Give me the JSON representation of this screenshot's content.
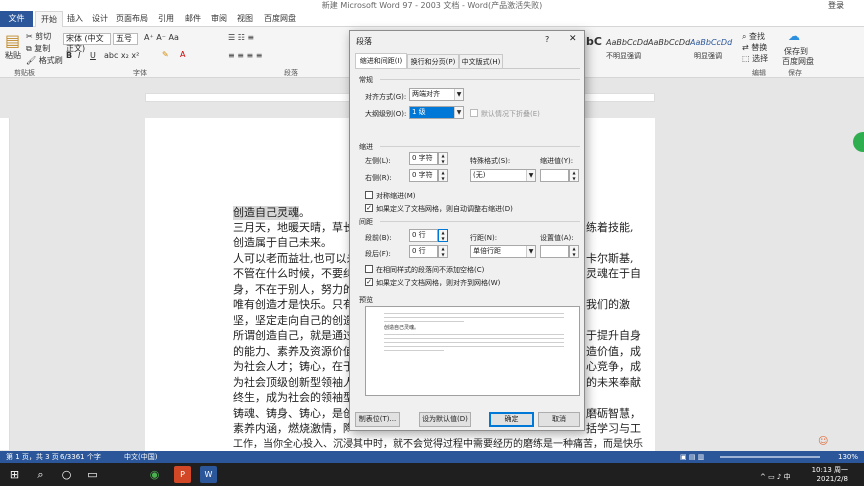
{
  "window": {
    "title": "新建 Microsoft Word 97 - 2003 文档 - Word(产品激活失败)",
    "login": "登录"
  },
  "menu": [
    "文件",
    "开始",
    "插入",
    "设计",
    "页面布局",
    "引用",
    "邮件",
    "审阅",
    "视图",
    "百度网盘"
  ],
  "ribbon": {
    "clipboard": {
      "paste": "粘贴",
      "cut": "剪切",
      "copy": "复制",
      "format_painter": "格式刷",
      "label": "剪贴板"
    },
    "font": {
      "name": "宋体 (中文正文)",
      "size": "五号",
      "label": "字体"
    },
    "paragraph_label": "段落",
    "styles": [
      "AaBbCcDd",
      "AaBbCcDd",
      "AaBbCcDd",
      "AaBbCcDd"
    ],
    "style_labels": [
      "不明显强调",
      "明显强调"
    ],
    "style_fragment": "bC",
    "editing": {
      "find": "查找",
      "replace": "替换",
      "select": "选择",
      "label": "编辑"
    },
    "baidu": {
      "save": "保存到",
      "save2": "百度网盘",
      "label": "保存"
    }
  },
  "document": {
    "lines": [
      "创造自己灵魂。",
      "三月天，地暖天晴，草长莺",
      "创造属于自己未来。",
      "人可以老而益壮,也可以未",
      "不管在什么时候，不要纠结",
      "身，不在于别人，努力的纟",
      "唯有创造才是快乐。只有创",
      "坚，坚定走向自己的创造自",
      "所谓创造自己，就是通过看",
      "的能力、素养及资源价值，",
      "为社会人才；铸心，在于提",
      "为社会顶级创新型领袖人术",
      "终生，成为社会的领袖型人",
      "铸魂、铸身、铸心，是创造",
      "素养内涵，燃烧激情，陶治",
      "工作，当你全心投入、沉浸其中时，就不会觉得过程中需要经历的磨练是一种痛苦，而是快乐"
    ],
    "right_lines": [
      "练着技能,",
      "卡尔斯基,",
      "灵魂在于自",
      "我们的激",
      "于提升自身",
      "造价值，成",
      "心竞争，成",
      "的未来奉献",
      "磨砺智慧，",
      "括学习与工"
    ]
  },
  "dialog": {
    "title": "段落",
    "help": "?",
    "close": "✕",
    "tabs": [
      "缩进和间距(I)",
      "换行和分页(P)",
      "中文版式(H)"
    ],
    "general": {
      "header": "常规",
      "alignment_label": "对齐方式(G):",
      "alignment_value": "两端对齐",
      "outline_label": "大纲级别(O):",
      "outline_value": "1 级",
      "collapse_label": "默认情况下折叠(E)"
    },
    "indent": {
      "header": "缩进",
      "left_label": "左侧(L):",
      "left_value": "0 字符",
      "right_label": "右侧(R):",
      "right_value": "0 字符",
      "special_label": "特殊格式(S):",
      "special_value": "(无)",
      "by_label": "缩进值(Y):",
      "mirror_label": "对称缩进(M)",
      "auto_adjust_label": "如果定义了文档网格，则自动调整右缩进(D)"
    },
    "spacing": {
      "header": "间距",
      "before_label": "段前(B):",
      "before_value": "0 行",
      "after_label": "段后(F):",
      "after_value": "0 行",
      "line_label": "行距(N):",
      "line_value": "单倍行距",
      "at_label": "设置值(A):",
      "no_space_label": "在相同样式的段落间不添加空格(C)",
      "snap_grid_label": "如果定义了文档网格，则对齐到网格(W)"
    },
    "preview": {
      "header": "预览",
      "sample": "创造自己灵魂。"
    },
    "buttons": {
      "tabs": "制表位(T)...",
      "default": "设为默认值(D)",
      "ok": "确定",
      "cancel": "取消"
    }
  },
  "status": {
    "page": "第 1 页，共 3 页",
    "words": "6/3361 个字",
    "lang": "中文(中国)",
    "zoom": "130%"
  },
  "taskbar": {
    "time": "10:13 周一",
    "date": "2021/2/8"
  },
  "colors": {
    "brand": "#2b579a",
    "accent": "#0078d7",
    "selection": "#3399ff"
  }
}
